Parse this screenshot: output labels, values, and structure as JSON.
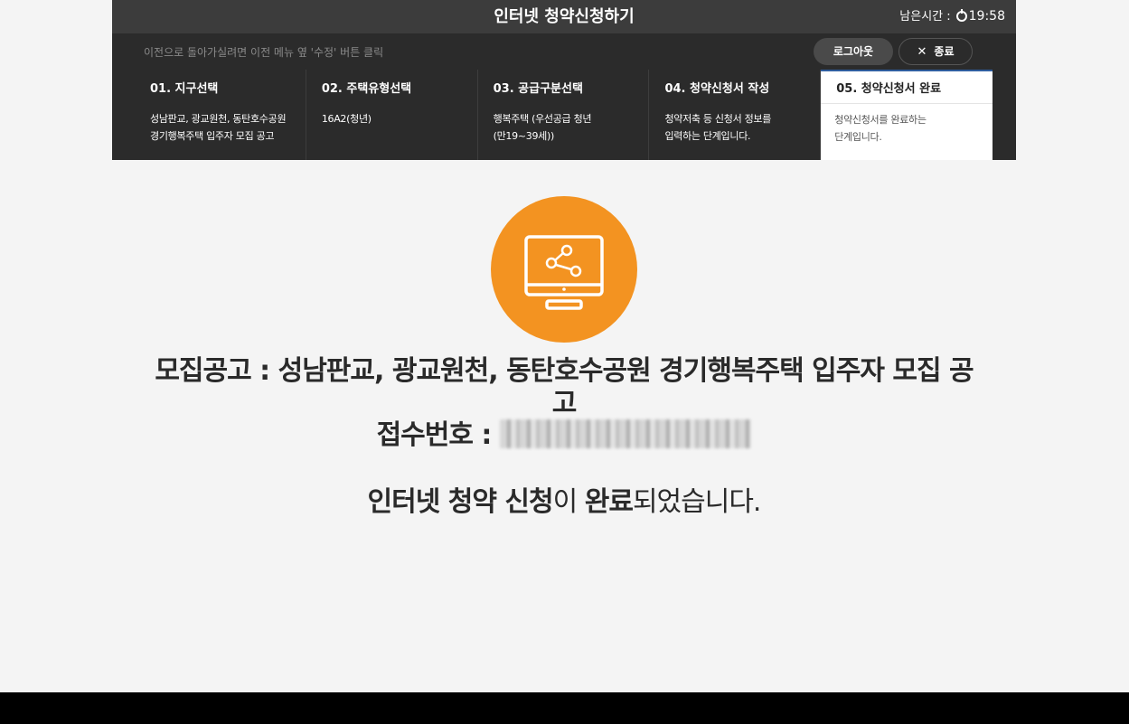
{
  "header": {
    "title": "인터넷 청약신청하기",
    "timer_label": "남은시간 :",
    "timer_value": "19:58",
    "hint": "이전으로 돌아가실려면 이전 메뉴 옆 '수정' 버튼 클릭",
    "logout_label": "로그아웃",
    "close_icon": "x-icon",
    "close_label": "종료"
  },
  "steps": [
    {
      "title": "01. 지구선택",
      "desc1": "성남판교, 광교원천, 동탄호수공원",
      "desc2": "경기행복주택 입주자 모집 공고"
    },
    {
      "title": "02. 주택유형선택",
      "desc1": "16A2(청년)",
      "desc2": ""
    },
    {
      "title": "03. 공급구분선택",
      "desc1": "행복주택 (우선공급 청년",
      "desc2": "(만19~39세))"
    },
    {
      "title": "04. 청약신청서 작성",
      "desc1": "청약저축 등 신청서 정보를",
      "desc2": "입력하는 단계입니다."
    },
    {
      "title": "05. 청약신청서 완료",
      "desc1": "청약신청서를 완료하는",
      "desc2": "단계입니다."
    }
  ],
  "main": {
    "icon": "monitor-share-icon",
    "accent_color": "#f39321",
    "notice_line1": "모집공고 : 성남판교, 광교원천, 동탄호수공원 경기행복주택 입주자 모집 공",
    "notice_line2": "고",
    "receipt_label": "접수번호 :",
    "done_part1": "인터넷 청약 신청",
    "done_part2": "이 ",
    "done_part3": "완료",
    "done_part4": "되었습니다."
  }
}
